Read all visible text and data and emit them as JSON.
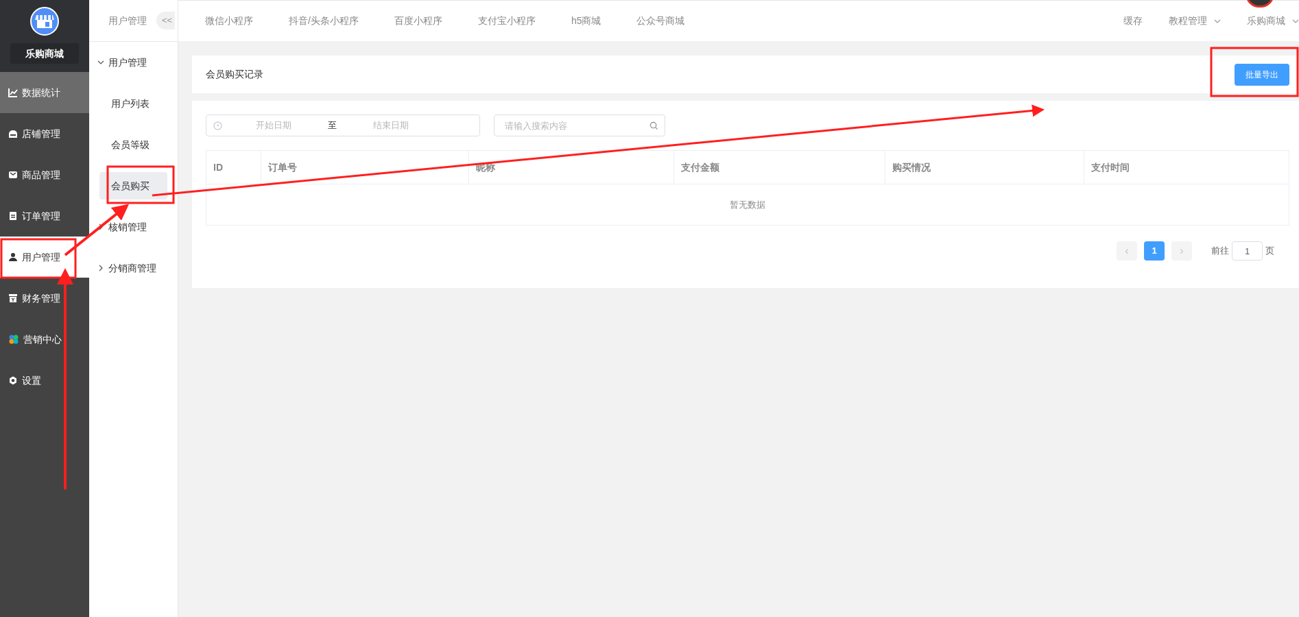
{
  "logo": {
    "name": "乐购商城"
  },
  "sidebar": {
    "items": [
      {
        "label": "数据统计",
        "selected": false,
        "hovered": true
      },
      {
        "label": "店铺管理",
        "selected": false,
        "hovered": false
      },
      {
        "label": "商品管理",
        "selected": false,
        "hovered": false
      },
      {
        "label": "订单管理",
        "selected": false,
        "hovered": false
      },
      {
        "label": "用户管理",
        "selected": true,
        "hovered": false
      },
      {
        "label": "财务管理",
        "selected": false,
        "hovered": false
      },
      {
        "label": "营销中心",
        "selected": false,
        "hovered": false
      },
      {
        "label": "设置",
        "selected": false,
        "hovered": false
      }
    ]
  },
  "submenu": {
    "title": "用户管理",
    "collapse_button": "<<",
    "groups": [
      {
        "label": "用户管理",
        "expanded": true,
        "children": [
          {
            "label": "用户列表",
            "selected": false
          },
          {
            "label": "会员等级",
            "selected": false
          },
          {
            "label": "会员购买",
            "selected": true
          }
        ]
      },
      {
        "label": "核销管理",
        "expanded": false
      },
      {
        "label": "分销商管理",
        "expanded": false
      }
    ]
  },
  "top_nav": {
    "tabs": [
      "微信小程序",
      "抖音/头条小程序",
      "百度小程序",
      "支付宝小程序",
      "h5商城",
      "公众号商城"
    ],
    "right": [
      {
        "label": "缓存",
        "dropdown": false
      },
      {
        "label": "教程管理",
        "dropdown": true
      },
      {
        "label": "乐购商城",
        "dropdown": true
      }
    ]
  },
  "page": {
    "title": "会员购买记录",
    "export_button": "批量导出"
  },
  "filters": {
    "start_placeholder": "开始日期",
    "separator": "至",
    "end_placeholder": "结束日期",
    "search_placeholder": "请输入搜索内容"
  },
  "table": {
    "columns": [
      "ID",
      "订单号",
      "昵称",
      "支付金额",
      "购买情况",
      "支付时间"
    ],
    "empty_text": "暂无数据"
  },
  "pagination": {
    "prev": "‹",
    "pages": [
      {
        "label": "1",
        "selected": true
      }
    ],
    "next": "›",
    "goto_label": "前往",
    "goto_value": "1",
    "page_suffix": "页"
  }
}
